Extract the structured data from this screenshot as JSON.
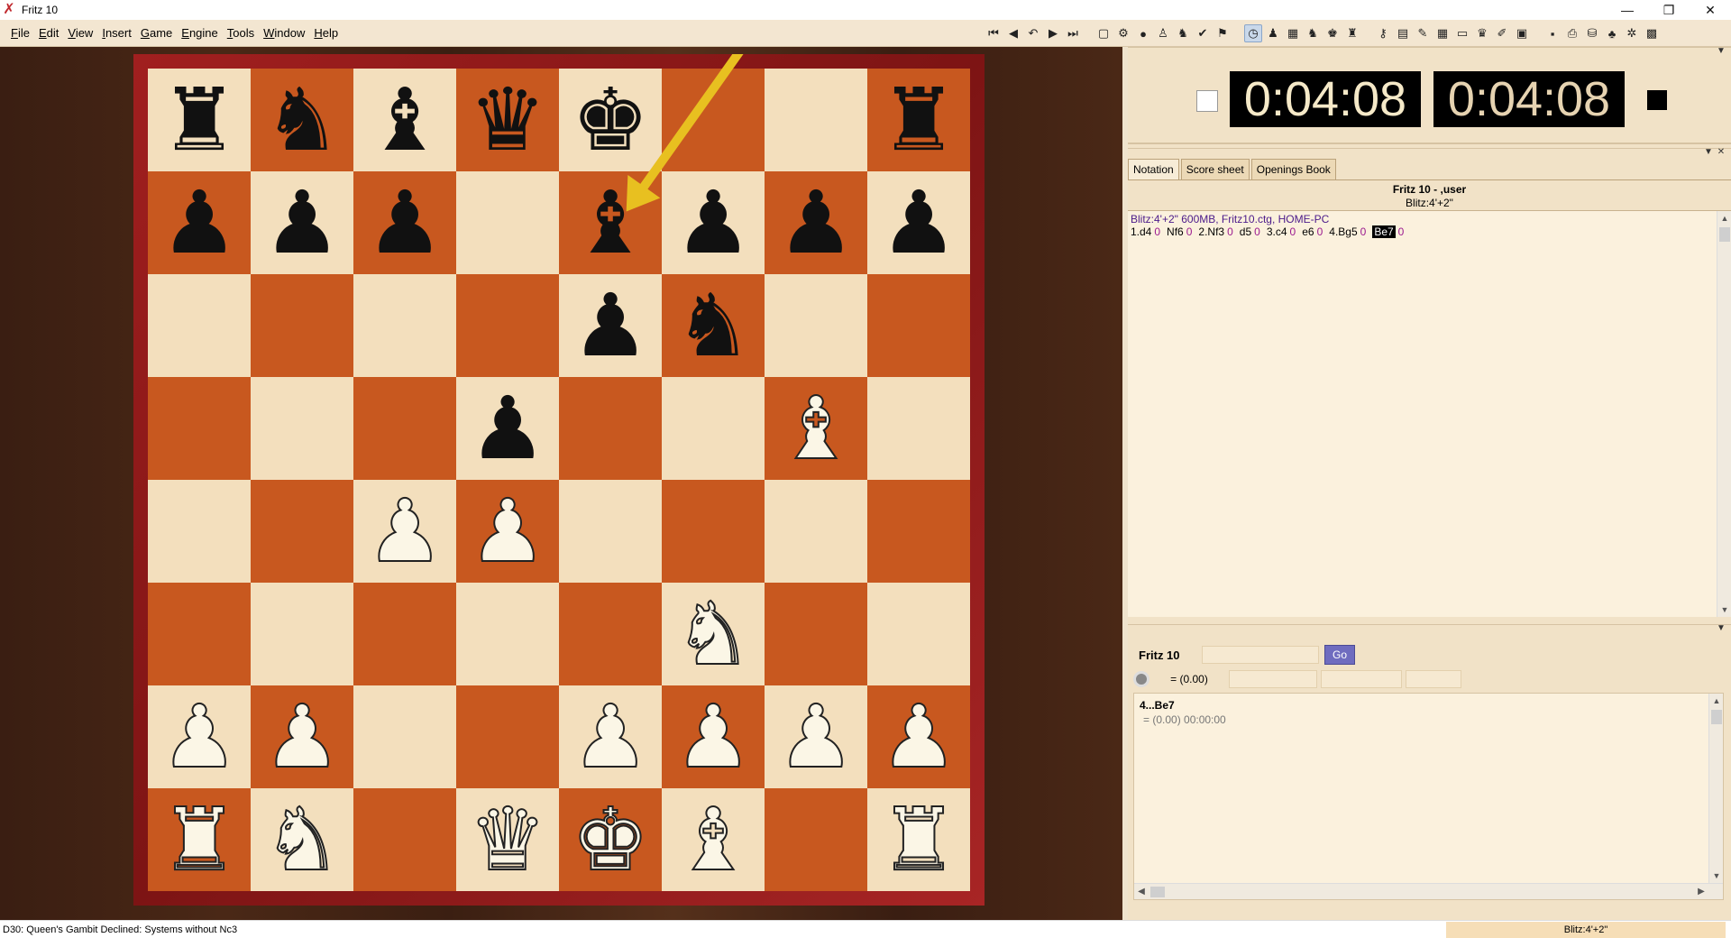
{
  "window": {
    "title": "Fritz 10",
    "icon": "fritz-logo-icon",
    "controls": [
      "minimize",
      "restore",
      "close"
    ]
  },
  "menu": [
    {
      "label": "File",
      "accel": "F"
    },
    {
      "label": "Edit",
      "accel": "E"
    },
    {
      "label": "View",
      "accel": "V"
    },
    {
      "label": "Insert",
      "accel": "I"
    },
    {
      "label": "Game",
      "accel": "G"
    },
    {
      "label": "Engine",
      "accel": "E"
    },
    {
      "label": "Tools",
      "accel": "T"
    },
    {
      "label": "Window",
      "accel": "W"
    },
    {
      "label": "Help",
      "accel": "H"
    }
  ],
  "toolbar": {
    "groups": [
      [
        "go-start-icon",
        "back-icon",
        "take-back-icon",
        "forward-icon",
        "go-end-icon"
      ],
      [
        "new-game-icon",
        "engine-icon",
        "hint-icon",
        "coach-icon",
        "pieces-icon",
        "accept-icon",
        "flag-icon"
      ],
      [
        "clock-icon",
        "pawn-icon",
        "board-icon",
        "knight-icon",
        "king-icon",
        "mascot-icon"
      ],
      [
        "key-icon",
        "book-icon",
        "edit-icon",
        "table-icon",
        "window-icon",
        "trophy-icon",
        "pen-icon",
        "layout-icon"
      ],
      [
        "save-icon",
        "print-icon",
        "database-icon",
        "tree-icon",
        "gears-icon",
        "calendar-icon"
      ]
    ]
  },
  "board": {
    "orientation": "white-bottom",
    "position": [
      [
        "bR",
        "bN",
        "bB",
        "bQ",
        "bK",
        "",
        "",
        "bR"
      ],
      [
        "bP",
        "bP",
        "bP",
        "",
        "bB",
        "bP",
        "bP",
        "bP"
      ],
      [
        "",
        "",
        "",
        "",
        "bP",
        "bN",
        "",
        ""
      ],
      [
        "",
        "",
        "",
        "bP",
        "",
        "",
        "wB",
        ""
      ],
      [
        "",
        "",
        "wP",
        "wP",
        "",
        "",
        "",
        ""
      ],
      [
        "",
        "",
        "",
        "",
        "",
        "wN",
        "",
        ""
      ],
      [
        "wP",
        "wP",
        "",
        "",
        "wP",
        "wP",
        "wP",
        "wP"
      ],
      [
        "wR",
        "wN",
        "",
        "wQ",
        "wK",
        "wB",
        "",
        "wR"
      ]
    ],
    "last_move_arrow": {
      "from": "g8",
      "to": "e7",
      "color": "#e8c020"
    }
  },
  "clocks": {
    "white": "0:04:08",
    "black": "0:04:08",
    "to_move": "black"
  },
  "notation": {
    "tabs": [
      "Notation",
      "Score sheet",
      "Openings Book"
    ],
    "active_tab": "Notation",
    "header_players": "Fritz 10 - ,user",
    "header_event": "Blitz:4'+2\"",
    "info_line": "Blitz:4'+2\"   600MB, Fritz10.ctg, HOME-PC",
    "moves": [
      {
        "move": "1.d4",
        "time": "0"
      },
      {
        "move": "Nf6",
        "time": "0"
      },
      {
        "move": "2.Nf3",
        "time": "0"
      },
      {
        "move": "d5",
        "time": "0"
      },
      {
        "move": "3.c4",
        "time": "0"
      },
      {
        "move": "e6",
        "time": "0"
      },
      {
        "move": "4.Bg5",
        "time": "0"
      },
      {
        "move": "Be7",
        "time": "0",
        "current": true
      }
    ]
  },
  "engine": {
    "name": "Fritz 10",
    "go_label": "Go",
    "eval": "=  (0.00)",
    "line_move": "4...Be7",
    "line_eval": "=  (0.00)     00:00:00"
  },
  "status": {
    "opening": "D30: Queen's Gambit Declined: Systems without Nc3",
    "time_control": "Blitz:4'+2\""
  }
}
